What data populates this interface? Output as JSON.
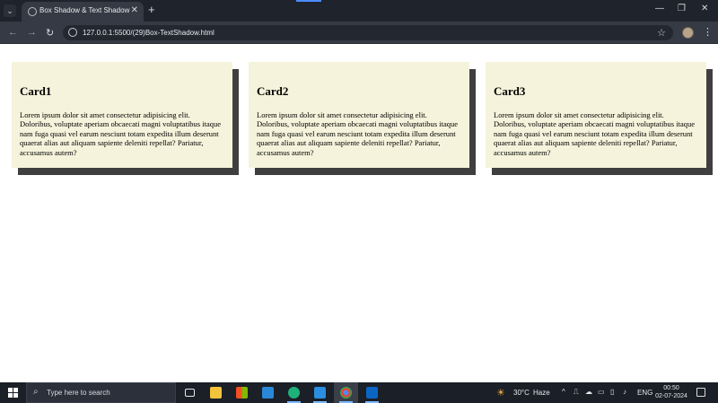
{
  "browser": {
    "tab_title": "Box Shadow & Text Shadow",
    "new_tab_symbol": "+",
    "url": "127.0.0.1:5500/(29)Box-TextShadow.html",
    "window_controls": {
      "minimize": "—",
      "restore": "❐",
      "close": "✕"
    }
  },
  "cards": [
    {
      "title": "Card1",
      "text": "Lorem ipsum dolor sit amet consectetur adipisicing elit. Doloribus, voluptate aperiam obcaecati magni voluptatibus itaque nam fuga quasi vel earum nesciunt totam expedita illum deserunt quaerat alias aut aliquam sapiente deleniti repellat? Pariatur, accusamus autem?"
    },
    {
      "title": "Card2",
      "text": "Lorem ipsum dolor sit amet consectetur adipisicing elit. Doloribus, voluptate aperiam obcaecati magni voluptatibus itaque nam fuga quasi vel earum nesciunt totam expedita illum deserunt quaerat alias aut aliquam sapiente deleniti repellat? Pariatur, accusamus autem?"
    },
    {
      "title": "Card3",
      "text": "Lorem ipsum dolor sit amet consectetur adipisicing elit. Doloribus, voluptate aperiam obcaecati magni voluptatibus itaque nam fuga quasi vel earum nesciunt totam expedita illum deserunt quaerat alias aut aliquam sapiente deleniti repellat? Pariatur, accusamus autem?"
    }
  ],
  "taskbar": {
    "search_placeholder": "Type here to search",
    "weather_temp": "30°C",
    "weather_desc": "Haze",
    "language": "ENG",
    "time": "00:50",
    "date": "02-07-2024",
    "apps": [
      "task-view",
      "file-explorer",
      "microsoft-store",
      "mail",
      "edge",
      "vscode",
      "chrome",
      "linkedin"
    ]
  },
  "colors": {
    "card_background": "#f5f3db",
    "card_shadow": "#3f3f3f",
    "browser_chrome": "#353a44",
    "taskbar": "#1b1f27"
  }
}
